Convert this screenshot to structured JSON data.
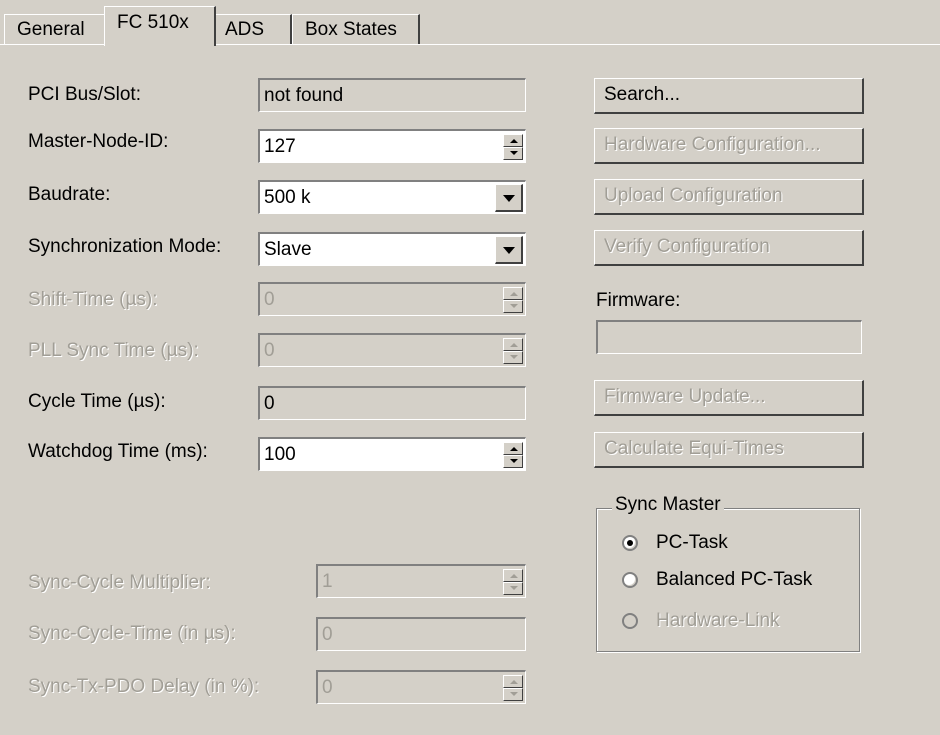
{
  "tabs": [
    "General",
    "FC 510x",
    "ADS",
    "Box States"
  ],
  "fields": {
    "pci_bus_slot": {
      "label": "PCI Bus/Slot:",
      "value": "not found"
    },
    "master_node_id": {
      "label": "Master-Node-ID:",
      "value": "127"
    },
    "baudrate": {
      "label": "Baudrate:",
      "value": "500 k"
    },
    "sync_mode": {
      "label": "Synchronization Mode:",
      "value": "Slave"
    },
    "shift_time": {
      "label": "Shift-Time (µs):",
      "value": "0"
    },
    "pll_sync_time": {
      "label": "PLL Sync Time (µs):",
      "value": "0"
    },
    "cycle_time": {
      "label": "Cycle Time (µs):",
      "value": "0"
    },
    "watchdog_time": {
      "label": "Watchdog Time (ms):",
      "value": "100"
    },
    "sync_cycle_multiplier": {
      "label": "Sync-Cycle Multiplier:",
      "value": "1"
    },
    "sync_cycle_time": {
      "label": "Sync-Cycle-Time (in µs):",
      "value": "0"
    },
    "sync_tx_pdo_delay": {
      "label": "Sync-Tx-PDO Delay (in %):",
      "value": "0"
    }
  },
  "buttons": {
    "search": "Search...",
    "hardware_configuration": "Hardware Configuration...",
    "upload_configuration": "Upload Configuration",
    "verify_configuration": "Verify Configuration",
    "firmware_update": "Firmware Update...",
    "calculate_equi_times": "Calculate Equi-Times"
  },
  "firmware": {
    "label": "Firmware:",
    "value": ""
  },
  "sync_master": {
    "title": "Sync Master",
    "options": [
      "PC-Task",
      "Balanced PC-Task",
      "Hardware-Link"
    ],
    "selected": "PC-Task"
  }
}
